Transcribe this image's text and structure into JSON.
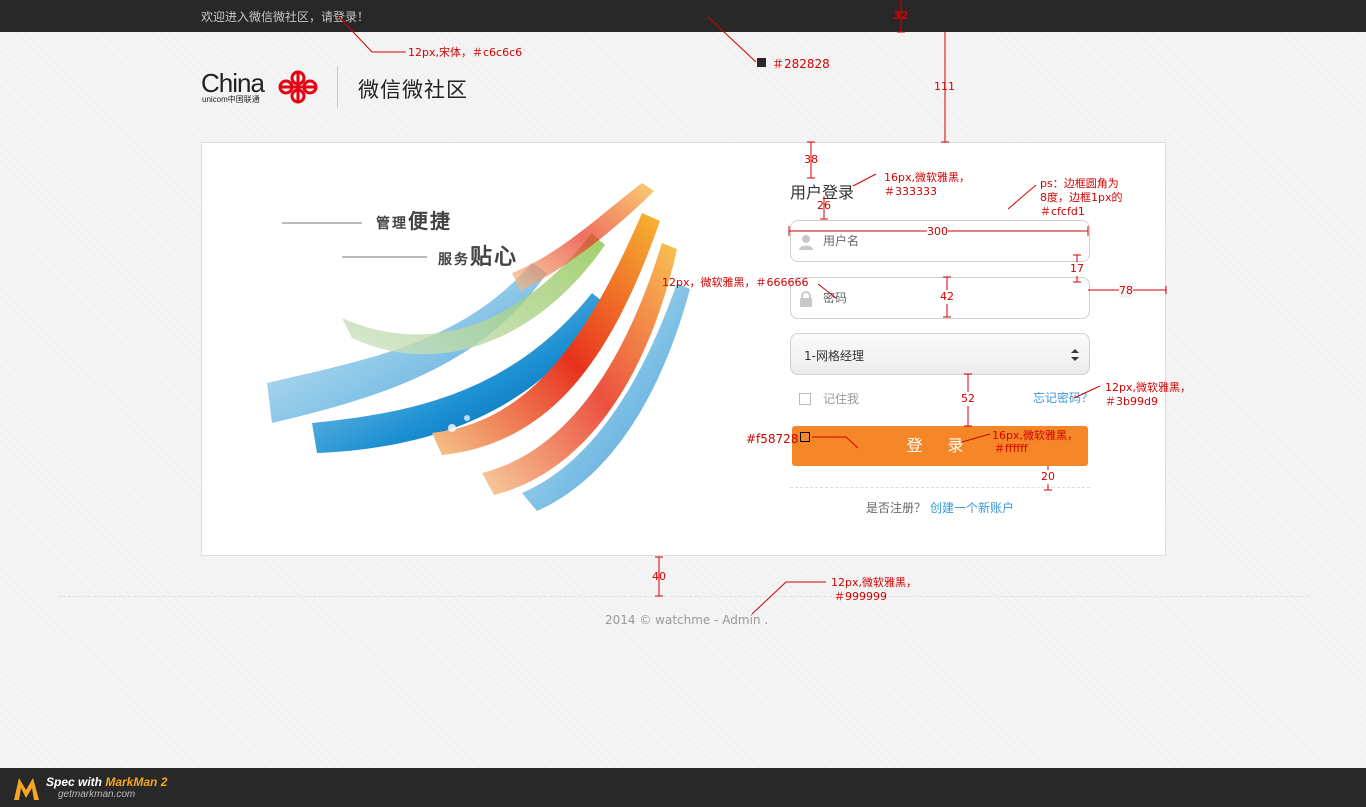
{
  "topbar": {
    "welcome": "欢迎进入微信微社区，请登录！"
  },
  "logo": {
    "china": "China",
    "unicom": "unicom中国联通",
    "title": "微信微社区"
  },
  "hero": {
    "line1_small": "管理",
    "line1_big": "便捷",
    "line2_small": "服务",
    "line2_big": "贴心"
  },
  "login": {
    "title": "用户登录",
    "username_placeholder": "用户名",
    "password_placeholder": "密码",
    "role_selected": "1-网格经理",
    "remember_label": "记住我",
    "forgot_link": "忘记密码？",
    "submit_label": "登 录",
    "register_prompt": "是否注册？",
    "register_link": "创建一个新账户"
  },
  "footer": {
    "copyright": "2014 © watchme - Admin ."
  },
  "colors": {
    "topbar_bg": "#282828",
    "button": "#f58728",
    "link": "#3b99d9",
    "border": "#cfcfd1"
  },
  "annotations": {
    "top_text_font": "12px,宋体，＃c6c6c6",
    "topbar_color": "＃282828",
    "top_height": "32",
    "logo_gap": "111",
    "panel_top_gap": "38",
    "title_font": "16px,微软雅黑，",
    "title_color": "＃333333",
    "title_gap": "26",
    "border_note_1": "ps：边框圆角为",
    "border_note_2": "8度，边框1px的",
    "border_note_3": "＃cfcfd1",
    "field_width": "300",
    "field_gap": "17",
    "placeholder_font": "12px，微软雅黑，＃666666",
    "field_height": "42",
    "right_gap": "78",
    "link_font": "12px,微软雅黑，",
    "link_color": "＃3b99d9",
    "button_gap": "52",
    "button_color": "#f58728",
    "button_font": "16px,微软雅黑，",
    "button_font_color": "＃ffffff",
    "divider_gap": "20",
    "footer_gap": "40",
    "footer_font": "12px,微软雅黑，",
    "footer_color": "＃999999"
  },
  "markman": {
    "line1_prefix": "Spec with ",
    "line1_brand": "MarkMan 2",
    "line2": "getmarkman.com"
  }
}
